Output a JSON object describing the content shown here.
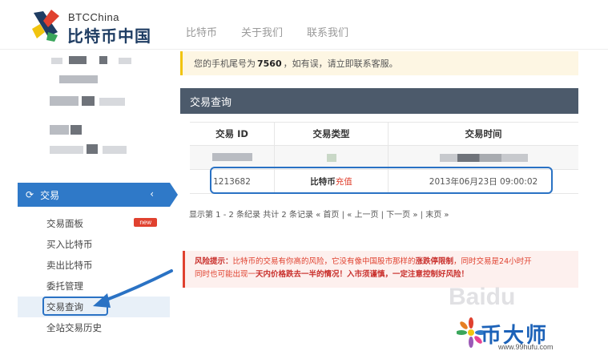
{
  "header": {
    "logo_small": "BTCChina",
    "logo_big": "比特币中国",
    "nav": [
      "比特币",
      "关于我们",
      "联系我们"
    ]
  },
  "notice": {
    "prefix": "您的手机尾号为",
    "phone_tail": "7560",
    "suffix": "，如有误，请立即联系客服。"
  },
  "sidebar": {
    "section_title": "交易",
    "menu": [
      {
        "label": "交易面板",
        "badge": "new"
      },
      {
        "label": "买入比特币"
      },
      {
        "label": "卖出比特币"
      },
      {
        "label": "委托管理"
      },
      {
        "label": "交易查询",
        "active": true
      },
      {
        "label": "全站交易历史"
      }
    ]
  },
  "panel": {
    "title": "交易查询",
    "columns": [
      "交易 ID",
      "交易类型",
      "交易时间"
    ],
    "row": {
      "id": "1213682",
      "type_main": "比特币",
      "type_suffix": "充值",
      "time": "2013年06月23日 09:00:02"
    }
  },
  "pager": "显示第 1 - 2 条纪录 共计 2 条记录 « 首页 | « 上一页 | 下一页 » | 末页 »",
  "risk": {
    "label": "风险提示：",
    "line1_text": "比特币的交易有你高的风险，它没有像中国股市那样的",
    "line1_bold": "涨跌停限制",
    "line1_tail": "，同时交易是24小时开",
    "line2_text": "同时也可能出现一",
    "line2_bold": "天内价格跌去一半的情况！入市须谨慎，一定注意控制好风险！"
  },
  "watermark": {
    "baidu": "Baidu",
    "brand": "币大师",
    "url": "www.99hufu.com"
  },
  "colors": {
    "accent": "#2f79c8",
    "panel_head": "#4c5a6b",
    "danger": "#e0412f",
    "notice_border": "#f1c40f"
  }
}
